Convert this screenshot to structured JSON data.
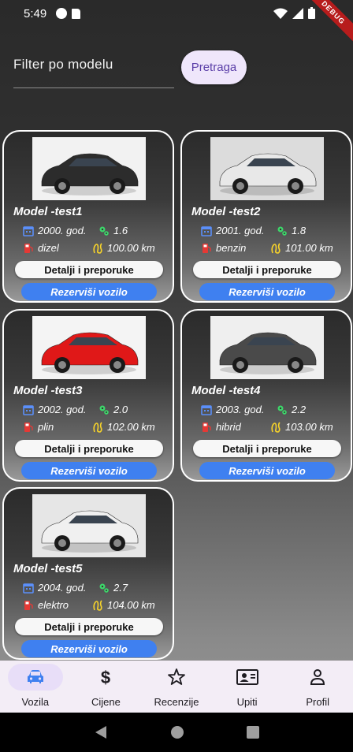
{
  "status_bar": {
    "time": "5:49",
    "debug_label": "DEBUG"
  },
  "filter": {
    "label": "Filter po modelu",
    "search_button": "Pretraga"
  },
  "cars": [
    {
      "model": "Model -test1",
      "year": "2000. god.",
      "engine": "1.6",
      "fuel": "dizel",
      "mileage": "100.00 km",
      "details_label": "Detalji i preporuke",
      "reserve_label": "Rezerviši vozilo",
      "car_color": "#2c2c2c",
      "bg_color": "#f2f2f2"
    },
    {
      "model": "Model -test2",
      "year": "2001. god.",
      "engine": "1.8",
      "fuel": "benzin",
      "mileage": "101.00 km",
      "details_label": "Detalji i preporuke",
      "reserve_label": "Rezerviši vozilo",
      "car_color": "#e8e8e8",
      "bg_color": "#dcdcdc"
    },
    {
      "model": "Model -test3",
      "year": "2002. god.",
      "engine": "2.0",
      "fuel": "plin",
      "mileage": "102.00 km",
      "details_label": "Detalji i preporuke",
      "reserve_label": "Rezerviši vozilo",
      "car_color": "#e01818",
      "bg_color": "#f4f4f4"
    },
    {
      "model": "Model -test4",
      "year": "2003. god.",
      "engine": "2.2",
      "fuel": "hibrid",
      "mileage": "103.00 km",
      "details_label": "Detalji i preporuke",
      "reserve_label": "Rezerviši vozilo",
      "car_color": "#4a4a4a",
      "bg_color": "#efefef"
    },
    {
      "model": "Model -test5",
      "year": "2004. god.",
      "engine": "2.7",
      "fuel": "elektro",
      "mileage": "104.00 km",
      "details_label": "Detalji i preporuke",
      "reserve_label": "Rezerviši vozilo",
      "car_color": "#f0f0f0",
      "bg_color": "#e6e6e6"
    }
  ],
  "bottom_nav": [
    {
      "label": "Vozila",
      "icon": "car-icon",
      "active": true
    },
    {
      "label": "Cijene",
      "icon": "dollar-icon",
      "active": false
    },
    {
      "label": "Recenzije",
      "icon": "star-icon",
      "active": false
    },
    {
      "label": "Upiti",
      "icon": "contact-card-icon",
      "active": false
    },
    {
      "label": "Profil",
      "icon": "person-icon",
      "active": false
    }
  ],
  "colors": {
    "accent_blue": "#3f80f0",
    "calendar_blue": "#5b8ff9",
    "gear_green": "#3dd66a",
    "fuel_red": "#e53935",
    "mileage_yellow": "#f7d32a",
    "nav_active": "#e8def8"
  }
}
